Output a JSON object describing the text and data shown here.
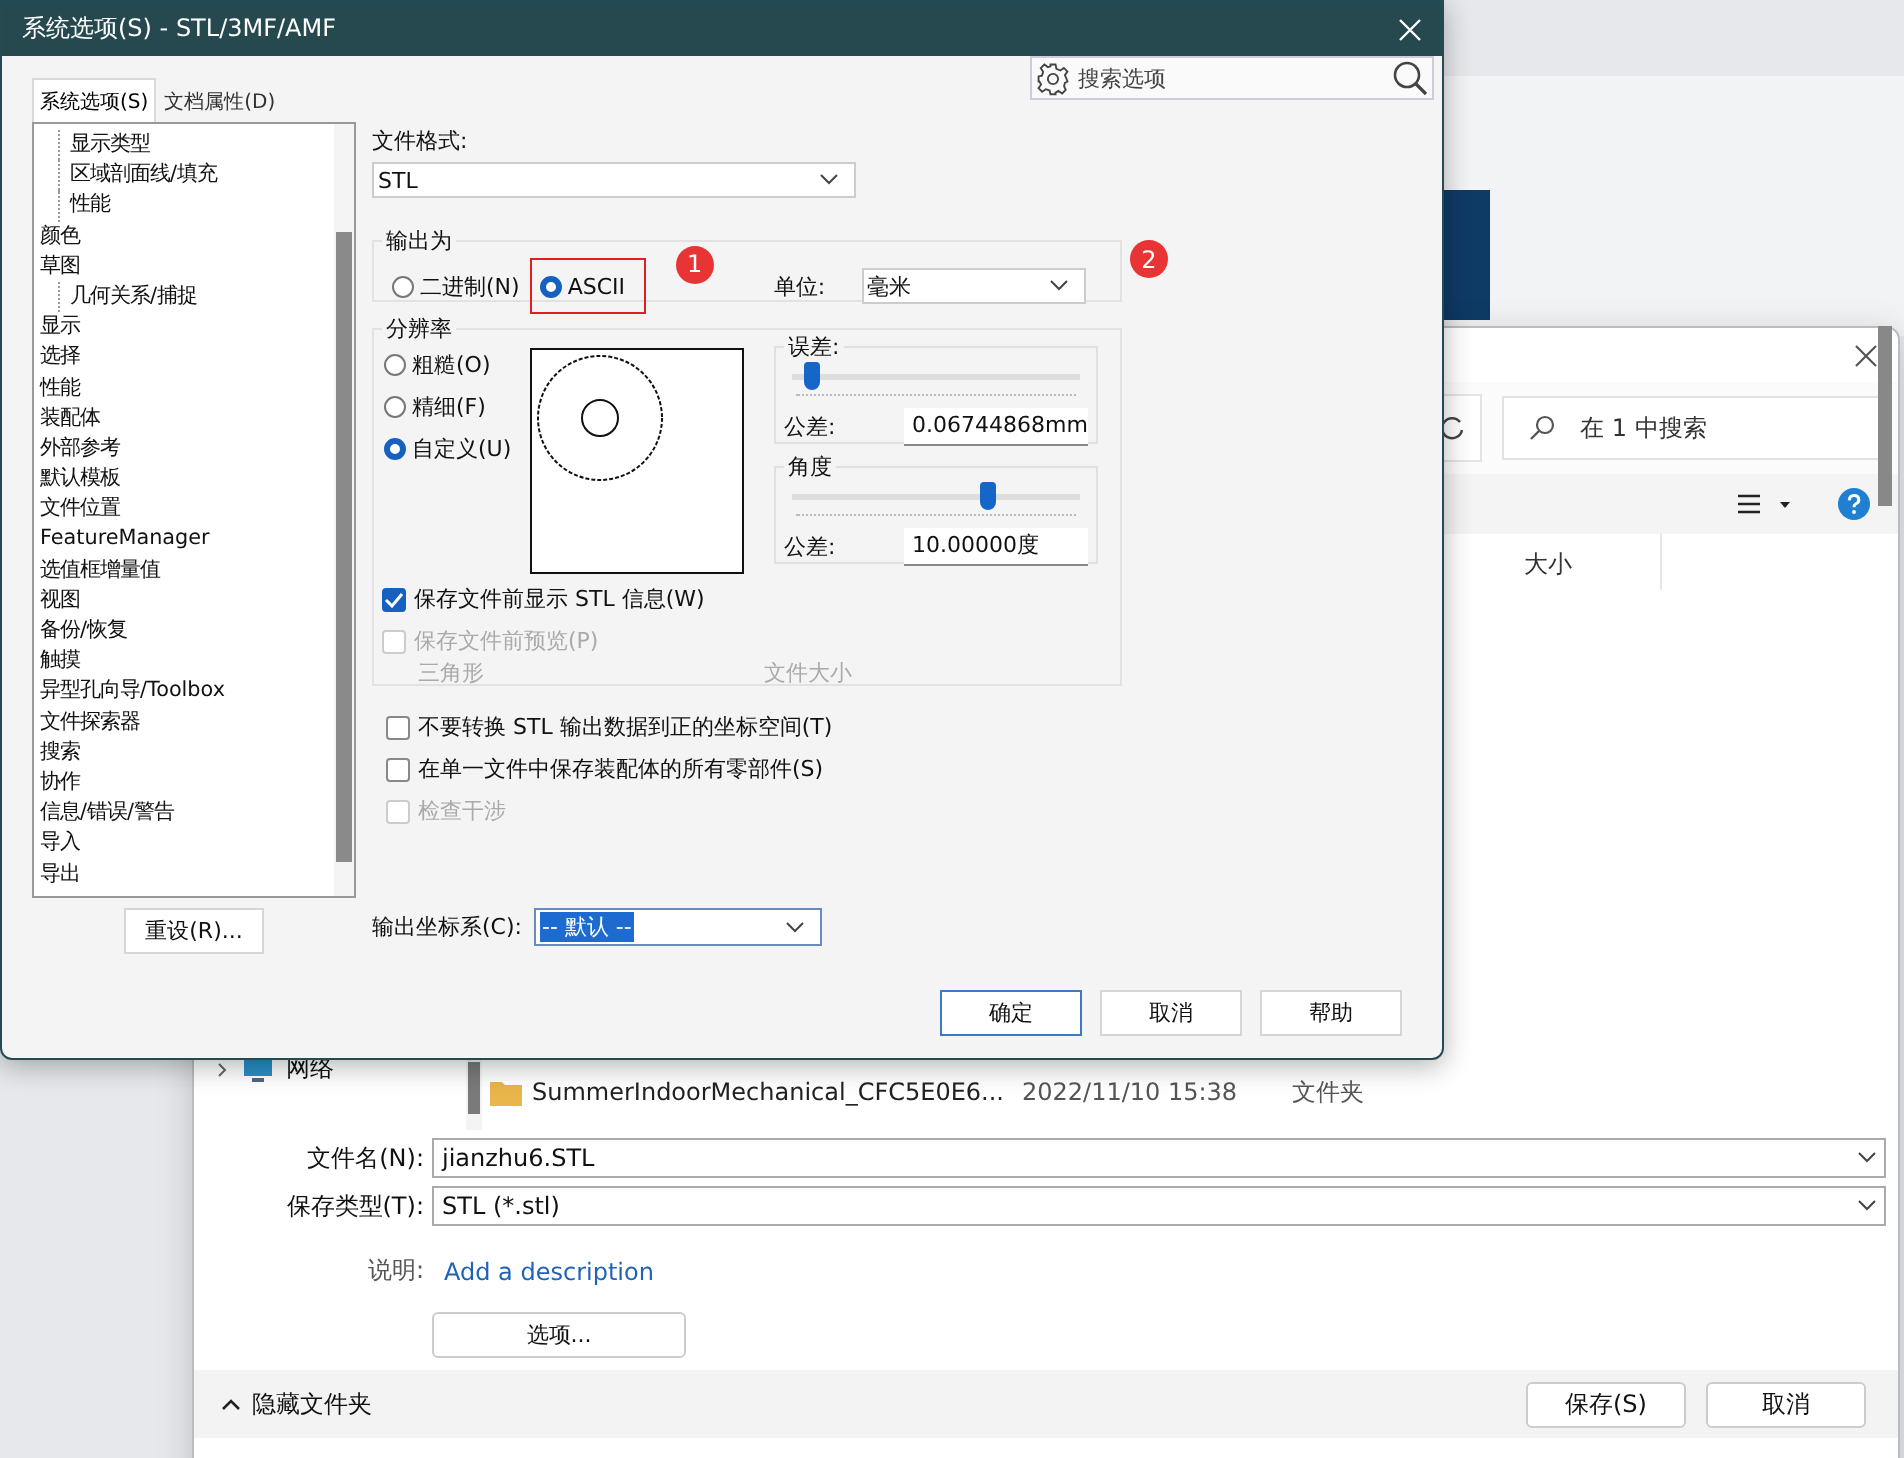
{
  "save_dialog": {
    "search": {
      "placeholder": "在 1 中搜索"
    },
    "columns": [
      "大小"
    ],
    "nav": [
      {
        "label": "网络",
        "expanded": false
      }
    ],
    "files": [
      {
        "name": "SummerIndoorMechanical_CFC5E0E6...",
        "modified": "2022/11/10 15:38",
        "type": "文件夹"
      }
    ],
    "file_name": {
      "label": "文件名(N):",
      "value": "jianzhu6.STL"
    },
    "save_type": {
      "label": "保存类型(T):",
      "value": "STL (*.stl)"
    },
    "description": {
      "label": "说明:",
      "link": "Add a description"
    },
    "options_button": "选项...",
    "hide_folders": "隐藏文件夹",
    "buttons": [
      "保存(S)",
      "取消"
    ]
  },
  "options_dialog": {
    "title": "系统选项(S) - STL/3MF/AMF",
    "tabs": [
      {
        "label": "系统选项(S)",
        "selected": true
      },
      {
        "label": "文档属性(D)",
        "selected": false
      }
    ],
    "search": {
      "placeholder": "搜索选项"
    },
    "tree": [
      {
        "children": [
          {
            "label": "显示类型"
          },
          {
            "label": "区域剖面线/填充"
          },
          {
            "label": "性能"
          }
        ]
      },
      {
        "label": "颜色"
      },
      {
        "label": "草图",
        "children": [
          {
            "label": "几何关系/捕捉"
          }
        ]
      },
      {
        "label": "显示"
      },
      {
        "label": "选择"
      },
      {
        "label": "性能"
      },
      {
        "label": "装配体"
      },
      {
        "label": "外部参考"
      },
      {
        "label": "默认模板"
      },
      {
        "label": "文件位置"
      },
      {
        "label": "FeatureManager"
      },
      {
        "label": "选值框增量值"
      },
      {
        "label": "视图"
      },
      {
        "label": "备份/恢复"
      },
      {
        "label": "触摸"
      },
      {
        "label": "异型孔向导/Toolbox"
      },
      {
        "label": "文件探索器"
      },
      {
        "label": "搜索"
      },
      {
        "label": "协作"
      },
      {
        "label": "信息/错误/警告"
      },
      {
        "label": "导入"
      },
      {
        "label": "导出"
      }
    ],
    "reset_button": "重设(R)...",
    "file_format": {
      "label": "文件格式:",
      "value": "STL"
    },
    "output_as": {
      "title": "输出为",
      "options": [
        {
          "label": "二进制(N)",
          "selected": false,
          "highlighted": false
        },
        {
          "label": "ASCII",
          "selected": true,
          "highlighted": true,
          "marker": "1"
        }
      ],
      "unit": {
        "label": "单位:",
        "value": "毫米",
        "marker": "2"
      }
    },
    "resolution": {
      "title": "分辨率",
      "options": [
        {
          "label": "粗糙(O)",
          "selected": false
        },
        {
          "label": "精细(F)",
          "selected": false
        },
        {
          "label": "自定义(U)",
          "selected": true
        }
      ],
      "deviation": {
        "title": "误差:",
        "level": 0.07,
        "label": "公差:",
        "value": "0.06744868mm"
      },
      "angle": {
        "title": "角度",
        "level": 0.68,
        "label": "公差:",
        "value": "10.00000度"
      },
      "checks": [
        {
          "label": "保存文件前显示 STL 信息(W)",
          "checked": true,
          "disabled": false
        },
        {
          "label": "保存文件前预览(P)",
          "checked": false,
          "disabled": true
        }
      ],
      "triangles_label": "三角形",
      "file_size_label": "文件大小"
    },
    "checks": [
      {
        "label": "不要转换 STL 输出数据到正的坐标空间(T)",
        "checked": false,
        "disabled": false
      },
      {
        "label": "在单一文件中保存装配体的所有零部件(S)",
        "checked": false,
        "disabled": false
      },
      {
        "label": "检查干涉",
        "checked": false,
        "disabled": true
      }
    ],
    "coordinate_system": {
      "label": "输出坐标系(C):",
      "value": "-- 默认 --",
      "selected": true
    },
    "buttons": [
      {
        "label": "确定",
        "default": true
      },
      {
        "label": "取消",
        "default": false
      },
      {
        "label": "帮助",
        "default": false
      }
    ]
  }
}
